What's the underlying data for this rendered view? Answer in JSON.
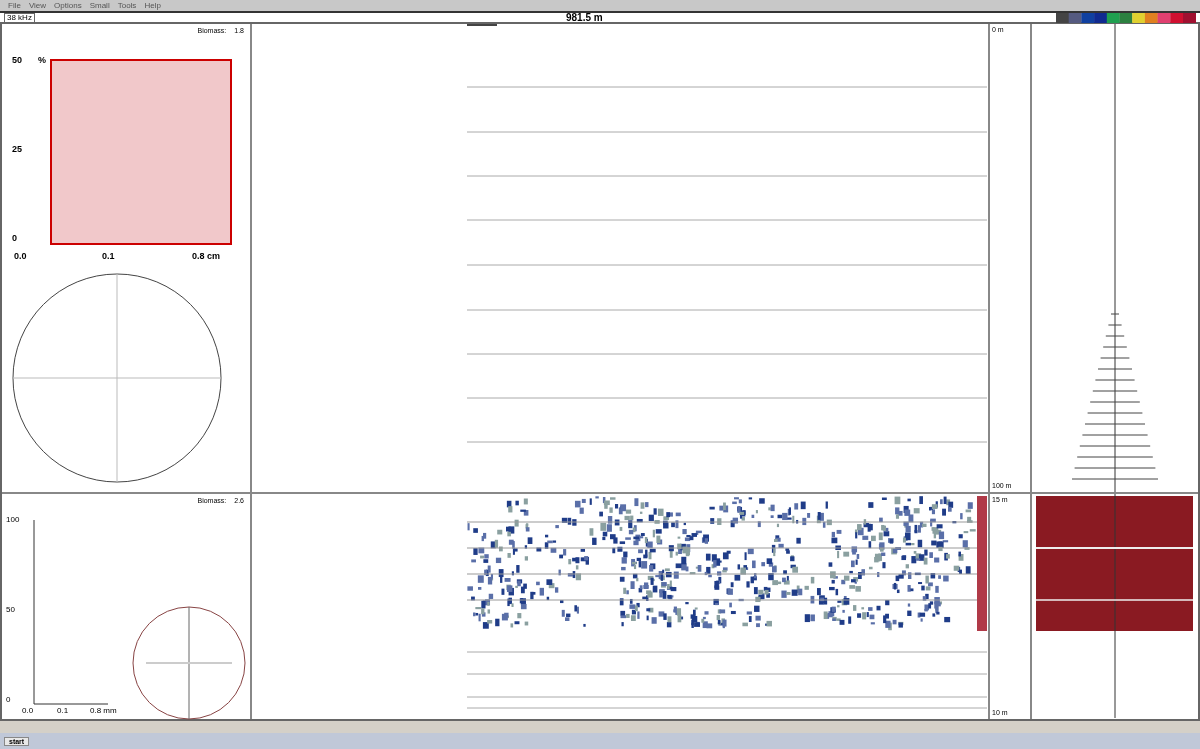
{
  "menu": [
    "File",
    "View",
    "Options",
    "Small",
    "Tools",
    "Help"
  ],
  "toolbar": {
    "frequency": "38 kHz",
    "distance": "981.5 m"
  },
  "top_histogram": {
    "biomass_label": "Biomass:",
    "biomass_value": "1.8",
    "y_unit": "%",
    "y_ticks": [
      "50",
      "25",
      "0"
    ],
    "x_ticks": [
      "0.0",
      "0.1",
      "0.8 cm"
    ]
  },
  "bottom_histogram": {
    "biomass_label": "Biomass:",
    "biomass_value": "2.6",
    "y_ticks": [
      "100",
      "50",
      "0"
    ],
    "x_ticks": [
      "0.0",
      "0.1",
      "0.8 mm"
    ]
  },
  "top_depth": {
    "start": "0 m",
    "end": "100 m"
  },
  "bottom_depth": {
    "start": "15 m",
    "end": "10 m"
  },
  "taskbar": {
    "start": "start"
  }
}
